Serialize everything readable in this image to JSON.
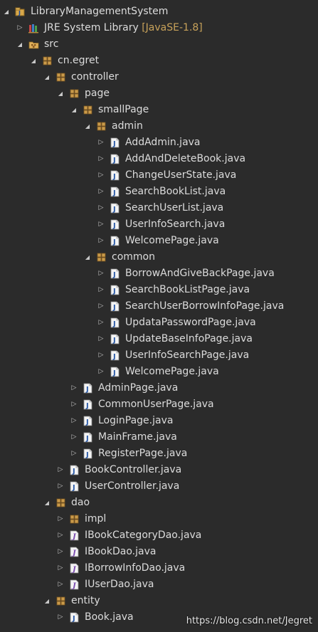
{
  "colors": {
    "background": "#2b2b2b",
    "text": "#dcdcdc",
    "decoration": "#c8a25a"
  },
  "tree": [
    {
      "label": "LibraryManagementSystem",
      "icon": "java-project-icon",
      "level": 0,
      "toggle": "expanded"
    },
    {
      "label": "JRE System Library",
      "decoration": "[JavaSE-1.8]",
      "icon": "library-icon",
      "level": 1,
      "toggle": "collapsed"
    },
    {
      "label": "src",
      "icon": "source-folder-icon",
      "level": 1,
      "toggle": "expanded"
    },
    {
      "label": "cn.egret",
      "icon": "package-icon",
      "level": 2,
      "toggle": "expanded"
    },
    {
      "label": "controller",
      "icon": "package-icon",
      "level": 3,
      "toggle": "expanded"
    },
    {
      "label": "page",
      "icon": "package-icon",
      "level": 4,
      "toggle": "expanded"
    },
    {
      "label": "smallPage",
      "icon": "package-icon",
      "level": 5,
      "toggle": "expanded"
    },
    {
      "label": "admin",
      "icon": "package-icon",
      "level": 6,
      "toggle": "expanded"
    },
    {
      "label": "AddAdmin.java",
      "icon": "java-file-icon",
      "level": 7,
      "toggle": "collapsed"
    },
    {
      "label": "AddAndDeleteBook.java",
      "icon": "java-file-icon",
      "level": 7,
      "toggle": "collapsed"
    },
    {
      "label": "ChangeUserState.java",
      "icon": "java-file-icon",
      "level": 7,
      "toggle": "collapsed"
    },
    {
      "label": "SearchBookList.java",
      "icon": "java-file-icon",
      "level": 7,
      "toggle": "collapsed"
    },
    {
      "label": "SearchUserList.java",
      "icon": "java-file-icon",
      "level": 7,
      "toggle": "collapsed"
    },
    {
      "label": "UserInfoSearch.java",
      "icon": "java-file-icon",
      "level": 7,
      "toggle": "collapsed"
    },
    {
      "label": "WelcomePage.java",
      "icon": "java-file-icon",
      "level": 7,
      "toggle": "collapsed"
    },
    {
      "label": "common",
      "icon": "package-icon",
      "level": 6,
      "toggle": "expanded"
    },
    {
      "label": "BorrowAndGiveBackPage.java",
      "icon": "java-file-icon",
      "level": 7,
      "toggle": "collapsed"
    },
    {
      "label": "SearchBookListPage.java",
      "icon": "java-file-icon",
      "level": 7,
      "toggle": "collapsed"
    },
    {
      "label": "SearchUserBorrowInfoPage.java",
      "icon": "java-file-icon",
      "level": 7,
      "toggle": "collapsed"
    },
    {
      "label": "UpdataPasswordPage.java",
      "icon": "java-file-icon",
      "level": 7,
      "toggle": "collapsed"
    },
    {
      "label": "UpdateBaseInfoPage.java",
      "icon": "java-file-icon",
      "level": 7,
      "toggle": "collapsed"
    },
    {
      "label": "UserInfoSearchPage.java",
      "icon": "java-file-icon",
      "level": 7,
      "toggle": "collapsed"
    },
    {
      "label": "WelcomePage.java",
      "icon": "java-file-icon",
      "level": 7,
      "toggle": "collapsed"
    },
    {
      "label": "AdminPage.java",
      "icon": "java-file-icon",
      "level": 5,
      "toggle": "collapsed"
    },
    {
      "label": "CommonUserPage.java",
      "icon": "java-file-icon",
      "level": 5,
      "toggle": "collapsed"
    },
    {
      "label": "LoginPage.java",
      "icon": "java-file-icon",
      "level": 5,
      "toggle": "collapsed"
    },
    {
      "label": "MainFrame.java",
      "icon": "java-file-icon",
      "level": 5,
      "toggle": "collapsed"
    },
    {
      "label": "RegisterPage.java",
      "icon": "java-file-icon",
      "level": 5,
      "toggle": "collapsed"
    },
    {
      "label": "BookController.java",
      "icon": "java-file-icon",
      "level": 4,
      "toggle": "collapsed"
    },
    {
      "label": "UserController.java",
      "icon": "java-file-icon",
      "level": 4,
      "toggle": "collapsed"
    },
    {
      "label": "dao",
      "icon": "package-icon",
      "level": 3,
      "toggle": "expanded"
    },
    {
      "label": "impl",
      "icon": "package-icon",
      "level": 4,
      "toggle": "collapsed"
    },
    {
      "label": "IBookCategoryDao.java",
      "icon": "java-interface-icon",
      "level": 4,
      "toggle": "collapsed"
    },
    {
      "label": "IBookDao.java",
      "icon": "java-interface-icon",
      "level": 4,
      "toggle": "collapsed"
    },
    {
      "label": "IBorrowInfoDao.java",
      "icon": "java-interface-icon",
      "level": 4,
      "toggle": "collapsed"
    },
    {
      "label": "IUserDao.java",
      "icon": "java-interface-icon",
      "level": 4,
      "toggle": "collapsed"
    },
    {
      "label": "entity",
      "icon": "package-icon",
      "level": 3,
      "toggle": "expanded"
    },
    {
      "label": "Book.java",
      "icon": "java-file-icon",
      "level": 4,
      "toggle": "collapsed"
    }
  ],
  "watermark": "https://blog.csdn.net/Jegret"
}
